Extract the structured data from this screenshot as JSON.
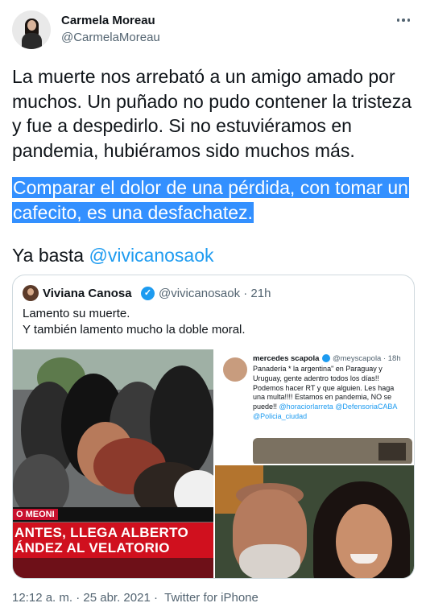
{
  "author": {
    "display_name": "Carmela Moreau",
    "handle": "@CarmelaMoreau",
    "avatar_icon": "profile-photo-icon"
  },
  "tweet": {
    "paragraph1": "La muerte nos arrebató a un amigo amado por muchos. Un puñado no pudo contener la tristeza y fue a despedirlo. Si no estuviéramos en pandemia, hubiéramos sido muchos más.",
    "paragraph2": "Comparar el dolor de una pérdida, con tomar un cafecito, es una desfachatez.",
    "paragraph3_prefix": "Ya basta ",
    "paragraph3_mention": "@vivicanosaok",
    "highlight_color": "#3390ff",
    "link_color": "#1d9bf0"
  },
  "quoted_tweet": {
    "display_name": "Viviana Canosa",
    "handle_time": "@vivicanosaok · 21h",
    "line1": "Lamento su muerte.",
    "line2": "Y también lamento mucho la doble moral.",
    "media": {
      "news_tag": "O MEONI",
      "chyron_line1": "ANTES, LLEGA ALBERTO",
      "chyron_line2": "ÁNDEZ AL VELATORIO",
      "screenshot": {
        "name": "mercedes scapola",
        "handle": "@meyscapola · 18h",
        "lines": [
          "Panadería * la argentina\" en Paraguay y",
          "Uruguay, gente adentro todos los días!!",
          "Podemos hacer RT y que alguien. Les haga",
          "una multa!!!! Estamos en pandemia, NO se",
          "puede!!"
        ],
        "mention1": "@horaciorlarreta",
        "mention2": "@DefensoriaCABA",
        "mention3": "@Policia_ciudad"
      }
    }
  },
  "meta": {
    "timestamp": "12:12 a. m. · 25 abr. 2021 · ",
    "source": "Twitter for iPhone"
  }
}
